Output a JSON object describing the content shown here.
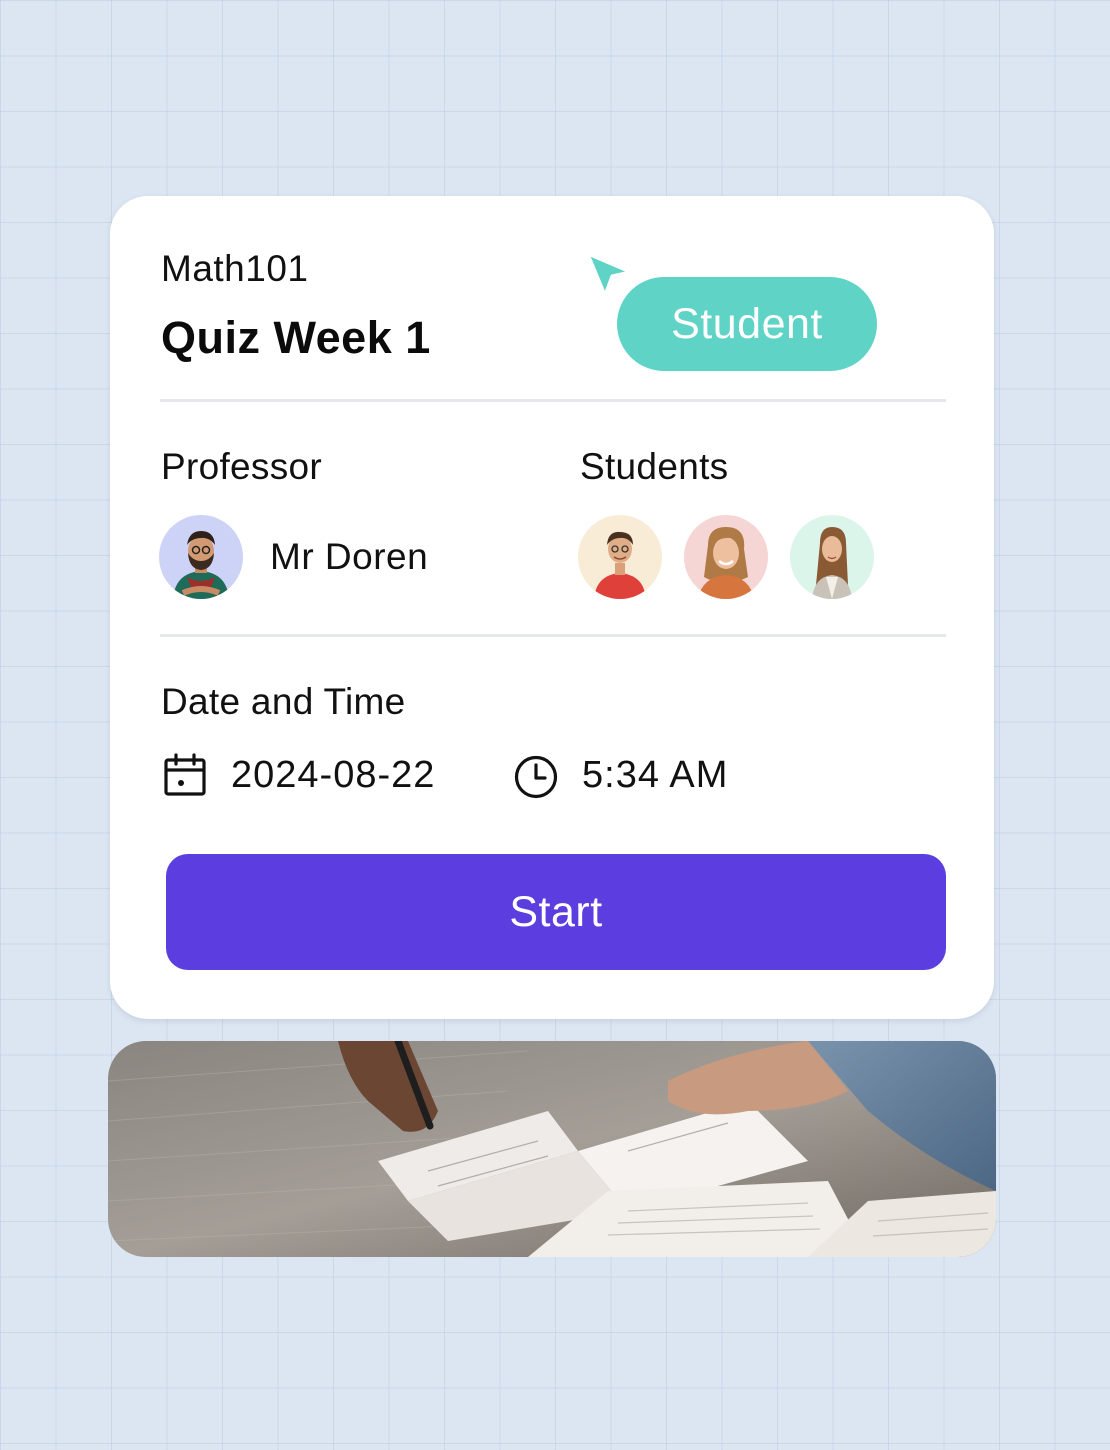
{
  "quiz": {
    "course": "Math101",
    "title": "Quiz Week 1",
    "role_badge": "Student"
  },
  "professor": {
    "label": "Professor",
    "name": "Mr Doren"
  },
  "students": {
    "label": "Students",
    "avatars": [
      "student-avatar-1",
      "student-avatar-2",
      "student-avatar-3"
    ]
  },
  "schedule": {
    "label": "Date and Time",
    "date": "2024-08-22",
    "time": "5:34 AM",
    "date_icon": "calendar-icon",
    "time_icon": "clock-icon"
  },
  "actions": {
    "start_label": "Start"
  },
  "colors": {
    "accent": "#5c3ddf",
    "badge": "#5fd3c5",
    "background": "#dce6f2",
    "avatar_prof_bg": "#cdd2f7",
    "avatar_1_bg": "#f8ecd6",
    "avatar_2_bg": "#f6d5d5",
    "avatar_3_bg": "#dcf5ea"
  }
}
